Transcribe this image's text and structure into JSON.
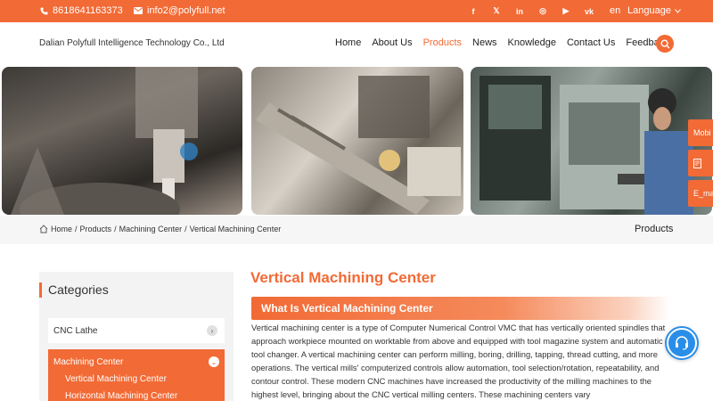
{
  "topbar": {
    "phone": "8618641163373",
    "email": "info2@polyfull.net",
    "socials": [
      {
        "icon": "facebook-icon",
        "glyph": "f"
      },
      {
        "icon": "x-icon",
        "glyph": "𝕏"
      },
      {
        "icon": "linkedin-icon",
        "glyph": "in"
      },
      {
        "icon": "instagram-icon",
        "glyph": "◎"
      },
      {
        "icon": "youtube-icon",
        "glyph": "▶"
      },
      {
        "icon": "vk-icon",
        "glyph": "vk"
      }
    ],
    "lang_code": "en",
    "language_label": "Language"
  },
  "header": {
    "brand": "Dalian Polyfull Intelligence Technology Co., Ltd",
    "nav": [
      "Home",
      "About Us",
      "Products",
      "News",
      "Knowledge",
      "Contact Us",
      "Feedback"
    ],
    "active_nav": "Products"
  },
  "sidetabs": [
    "Mobi",
    "",
    "E_mai"
  ],
  "breadcrumb": {
    "items": [
      "Home",
      "Products",
      "Machining Center",
      "Vertical Machining Center"
    ],
    "section_title": "Products"
  },
  "sidebar": {
    "heading": "Categories",
    "categories": [
      {
        "label": "CNC Lathe",
        "expanded": false
      },
      {
        "label": "Machining Center",
        "expanded": true,
        "children": [
          "Vertical Machining Center",
          "Horizontal Machining Center"
        ]
      }
    ]
  },
  "main": {
    "title": "Vertical Machining Center",
    "section_heading": "What Is Vertical Machining Center",
    "paragraph": "Vertical machining center is a type of Computer Numerical Control VMC that has vertically oriented spindles that approach workpiece mounted on worktable from above and equipped with tool magazine system and automatic tool changer. A vertical machining center can perform milling, boring, drilling, tapping, thread cutting, and more operations. The vertical mills' computerized controls allow automation, tool selection/rotation, repeatability, and contour control. These modern CNC machines have increased the productivity of the milling machines to the highest level, bringing about the CNC vertical milling centers. These machining centers vary"
  },
  "colors": {
    "accent": "#f26a35",
    "chat": "#2a8ee8"
  }
}
